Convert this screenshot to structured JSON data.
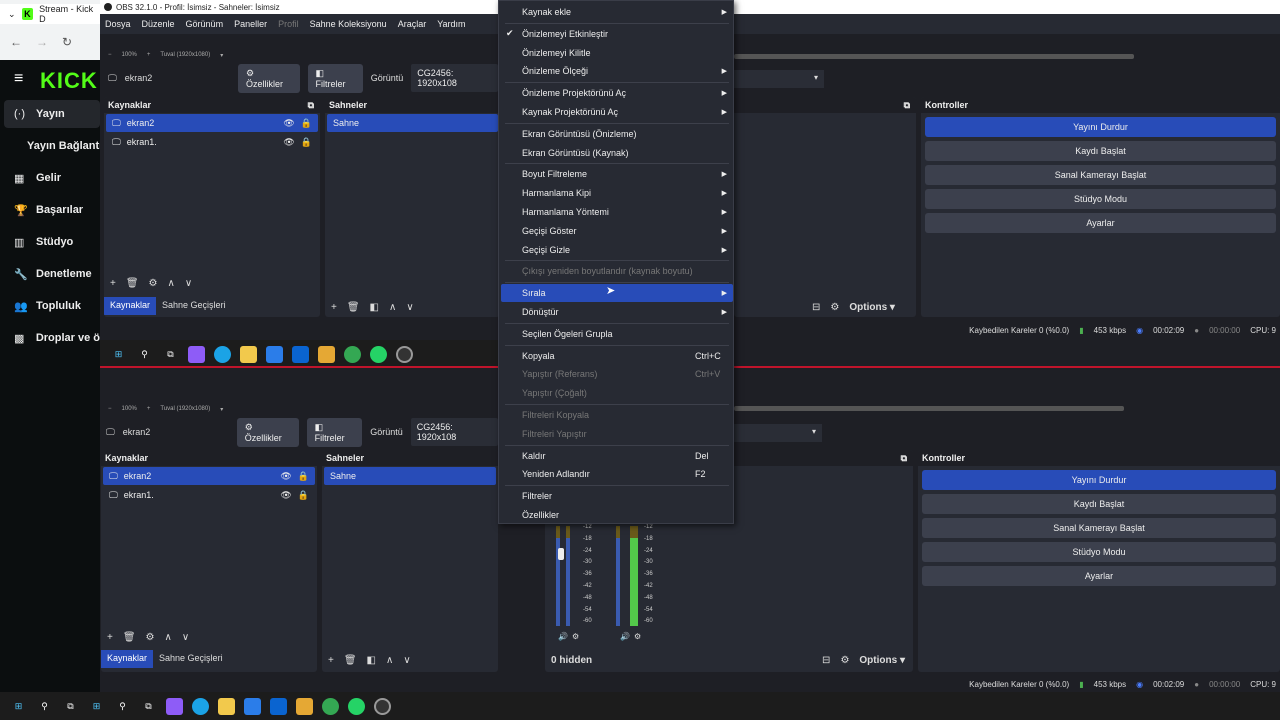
{
  "browser": {
    "tab_title": "Stream - Kick D",
    "kick_logo": "KICK"
  },
  "kick_nav": [
    {
      "label": "Yayın",
      "icon": "(·)"
    },
    {
      "label": "Yayın Bağlantı",
      "icon": ""
    },
    {
      "label": "Gelir",
      "icon": "▦"
    },
    {
      "label": "Başarılar",
      "icon": "🏆"
    },
    {
      "label": "Stüdyo",
      "icon": "▥"
    },
    {
      "label": "Denetleme",
      "icon": "🔧"
    },
    {
      "label": "Topluluk",
      "icon": "👥"
    },
    {
      "label": "Droplar ve ö",
      "icon": "▩"
    }
  ],
  "obs": {
    "title": "OBS 32.1.0 - Profil: İsimsiz - Sahneler: İsimsiz",
    "menu": [
      "Dosya",
      "Düzenle",
      "Görünüm",
      "Paneller",
      "Profil",
      "Sahne Koleksiyonu",
      "Araçlar",
      "Yardım"
    ],
    "zoom": "100%",
    "canvas": "Tuval (1920x1080)",
    "source_name": "ekran2",
    "properties": "Özellikler",
    "filters": "Filtreler",
    "display_label": "Görüntü",
    "display_value": "CG2456: 1920x108",
    "sources_title": "Kaynaklar",
    "sources": [
      "ekran2",
      "ekran1."
    ],
    "scenes_title": "Sahneler",
    "scenes": [
      "Sahne"
    ],
    "controls_title": "Kontroller",
    "controls": [
      "Yayını Durdur",
      "Kaydı Başlat",
      "Sanal Kamerayı Başlat",
      "Stüdyo Modu",
      "Ayarlar"
    ],
    "tab_sources": "Kaynaklar",
    "tab_transitions": "Sahne Geçişleri",
    "options": "Options",
    "hidden": "0 hidden",
    "meter_ticks": [
      "-12",
      "-18",
      "-24",
      "-30",
      "-36",
      "-42",
      "-48",
      "-54",
      "-60"
    ],
    "status": {
      "dropped": "Kaybedilen Kareler 0 (%0.0)",
      "bitrate": "453 kbps",
      "time": "00:02:09",
      "rec": "00:00:00",
      "cpu": "CPU: 9"
    }
  },
  "context_menu": [
    {
      "label": "Kaynak ekle",
      "arrow": true
    },
    {
      "sep": true
    },
    {
      "label": "Önizlemeyi Etkinleştir",
      "check": true
    },
    {
      "label": "Önizlemeyi Kilitle"
    },
    {
      "label": "Önizleme Ölçeği",
      "arrow": true
    },
    {
      "sep": true
    },
    {
      "label": "Önizleme Projektörünü Aç",
      "arrow": true
    },
    {
      "label": "Kaynak Projektörünü Aç",
      "arrow": true
    },
    {
      "sep": true
    },
    {
      "label": "Ekran Görüntüsü (Önizleme)"
    },
    {
      "label": "Ekran Görüntüsü (Kaynak)"
    },
    {
      "sep": true
    },
    {
      "label": "Boyut Filtreleme",
      "arrow": true
    },
    {
      "label": "Harmanlama Kipi",
      "arrow": true
    },
    {
      "label": "Harmanlama Yöntemi",
      "arrow": true
    },
    {
      "label": "Geçişi Göster",
      "arrow": true
    },
    {
      "label": "Geçişi Gizle",
      "arrow": true
    },
    {
      "sep": true
    },
    {
      "label": "Çıkışı yeniden boyutlandır (kaynak boyutu)",
      "disabled": true
    },
    {
      "sep": true
    },
    {
      "label": "Sırala",
      "arrow": true,
      "highlight": true
    },
    {
      "label": "Dönüştür",
      "arrow": true
    },
    {
      "sep": true
    },
    {
      "label": "Seçilen Ögeleri Grupla"
    },
    {
      "sep": true
    },
    {
      "label": "Kopyala",
      "shortcut": "Ctrl+C"
    },
    {
      "label": "Yapıştır (Referans)",
      "shortcut": "Ctrl+V",
      "disabled": true
    },
    {
      "label": "Yapıştır (Çoğalt)",
      "disabled": true
    },
    {
      "sep": true
    },
    {
      "label": "Filtreleri Kopyala",
      "disabled": true
    },
    {
      "label": "Filtreleri Yapıştır",
      "disabled": true
    },
    {
      "sep": true
    },
    {
      "label": "Kaldır",
      "shortcut": "Del"
    },
    {
      "label": "Yeniden Adlandır",
      "shortcut": "F2"
    },
    {
      "sep": true
    },
    {
      "label": "Filtreler"
    },
    {
      "label": "Özellikler"
    }
  ],
  "colors": {
    "accent": "#284cb8",
    "kick_green": "#53fc18",
    "panel": "#272a33",
    "bg": "#1e1f25"
  }
}
